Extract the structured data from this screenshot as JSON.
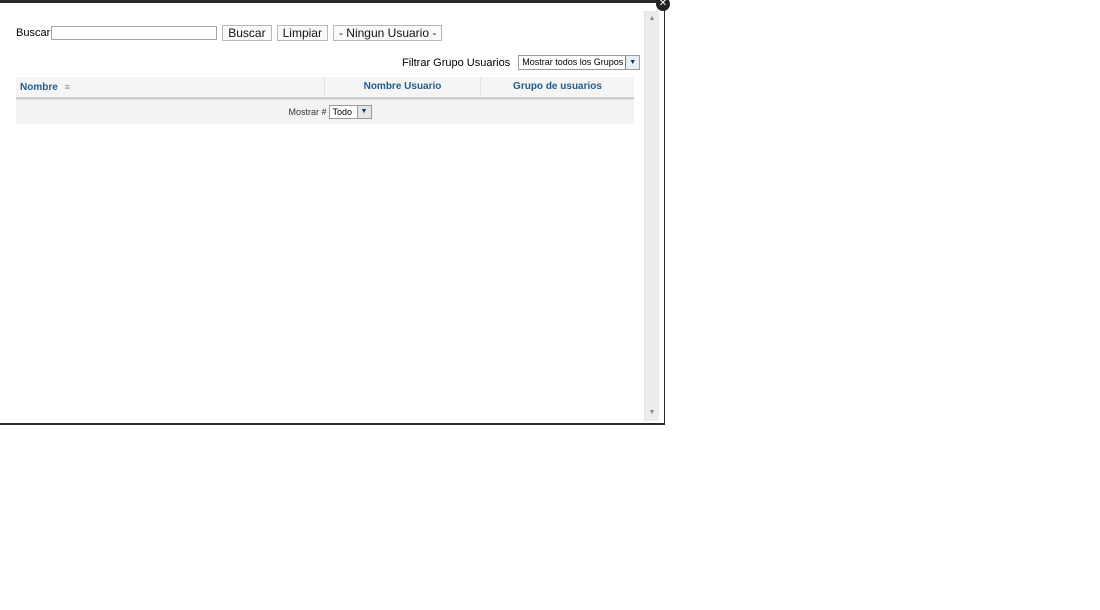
{
  "search": {
    "label": "Buscar",
    "value": "",
    "placeholder": ""
  },
  "buttons": {
    "search": "Buscar",
    "clear": "Limpiar",
    "none_user": "- Ningun Usuario -"
  },
  "filter": {
    "label": "Filtrar Grupo Usuarios",
    "selected": "Mostrar todos los Grupos"
  },
  "grid": {
    "columns": [
      {
        "label": "Nombre"
      },
      {
        "label": "Nombre Usuario"
      },
      {
        "label": "Grupo de usuarios"
      }
    ]
  },
  "footer": {
    "display_label": "Mostrar #",
    "display_value": "Todo"
  },
  "icons": {
    "close": "close-icon",
    "sort": "sort-ascending-icon"
  }
}
